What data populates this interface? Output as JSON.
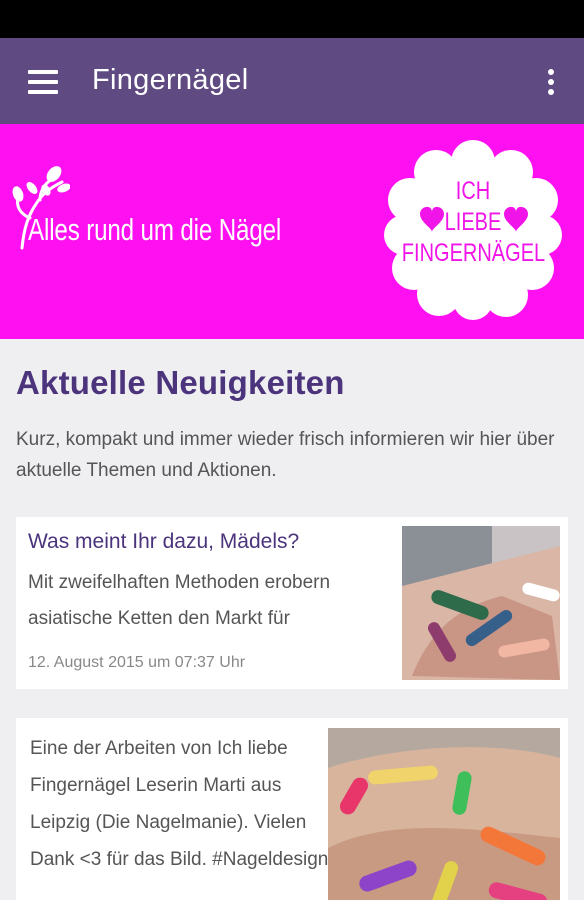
{
  "app_bar": {
    "title": "Fingernägel",
    "menu_icon": "hamburger-menu-icon",
    "overflow_icon": "more-vert-icon"
  },
  "banner": {
    "slogan": "Alles rund um die Nägel",
    "badge_lines": [
      "ICH",
      "LIEBE",
      "FINGERNÄGEL"
    ],
    "background": "#ff10f0"
  },
  "news": {
    "title": "Aktuelle Neuigkeiten",
    "intro": "Kurz, kompakt und immer wieder frisch informieren wir hier über aktuelle Themen und Aktionen.",
    "items": [
      {
        "title": "Was meint Ihr dazu, Mädels?",
        "excerpt": "Mit zweifelhaften Methoden erobern asiatische Ketten den Markt für",
        "date": "12. August 2015 um 07:37 Uhr"
      },
      {
        "excerpt": "Eine der Arbeiten von Ich liebe Fingernägel Leserin Marti aus Leipzig (Die Nagelmanie). Vielen Dank <3 für das Bild. #Nageldesign"
      }
    ]
  },
  "colors": {
    "app_bar": "#5f4a82",
    "accent_text": "#4b347c",
    "banner_pink": "#ff10f0"
  }
}
